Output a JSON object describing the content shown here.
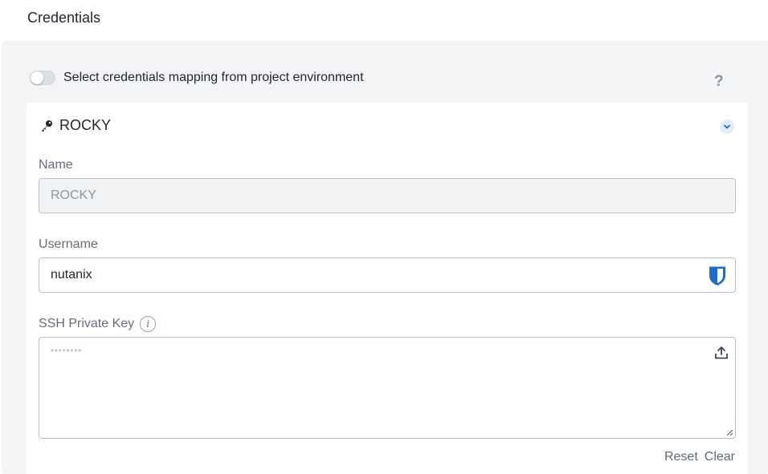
{
  "page": {
    "title": "Credentials"
  },
  "mapping_toggle": {
    "label": "Select credentials mapping from project environment",
    "enabled": false
  },
  "help": {
    "glyph": "?"
  },
  "credential": {
    "name": "ROCKY",
    "fields": {
      "name_label": "Name",
      "name_value": "ROCKY",
      "username_label": "Username",
      "username_value": "nutanix",
      "ssh_key_label": "SSH Private Key",
      "ssh_key_info": "i",
      "ssh_key_placeholder": "********"
    },
    "actions": {
      "reset": "Reset",
      "clear": "Clear"
    }
  },
  "colors": {
    "accent": "#1b6dd1",
    "panel_bg": "#f3f4f6"
  }
}
